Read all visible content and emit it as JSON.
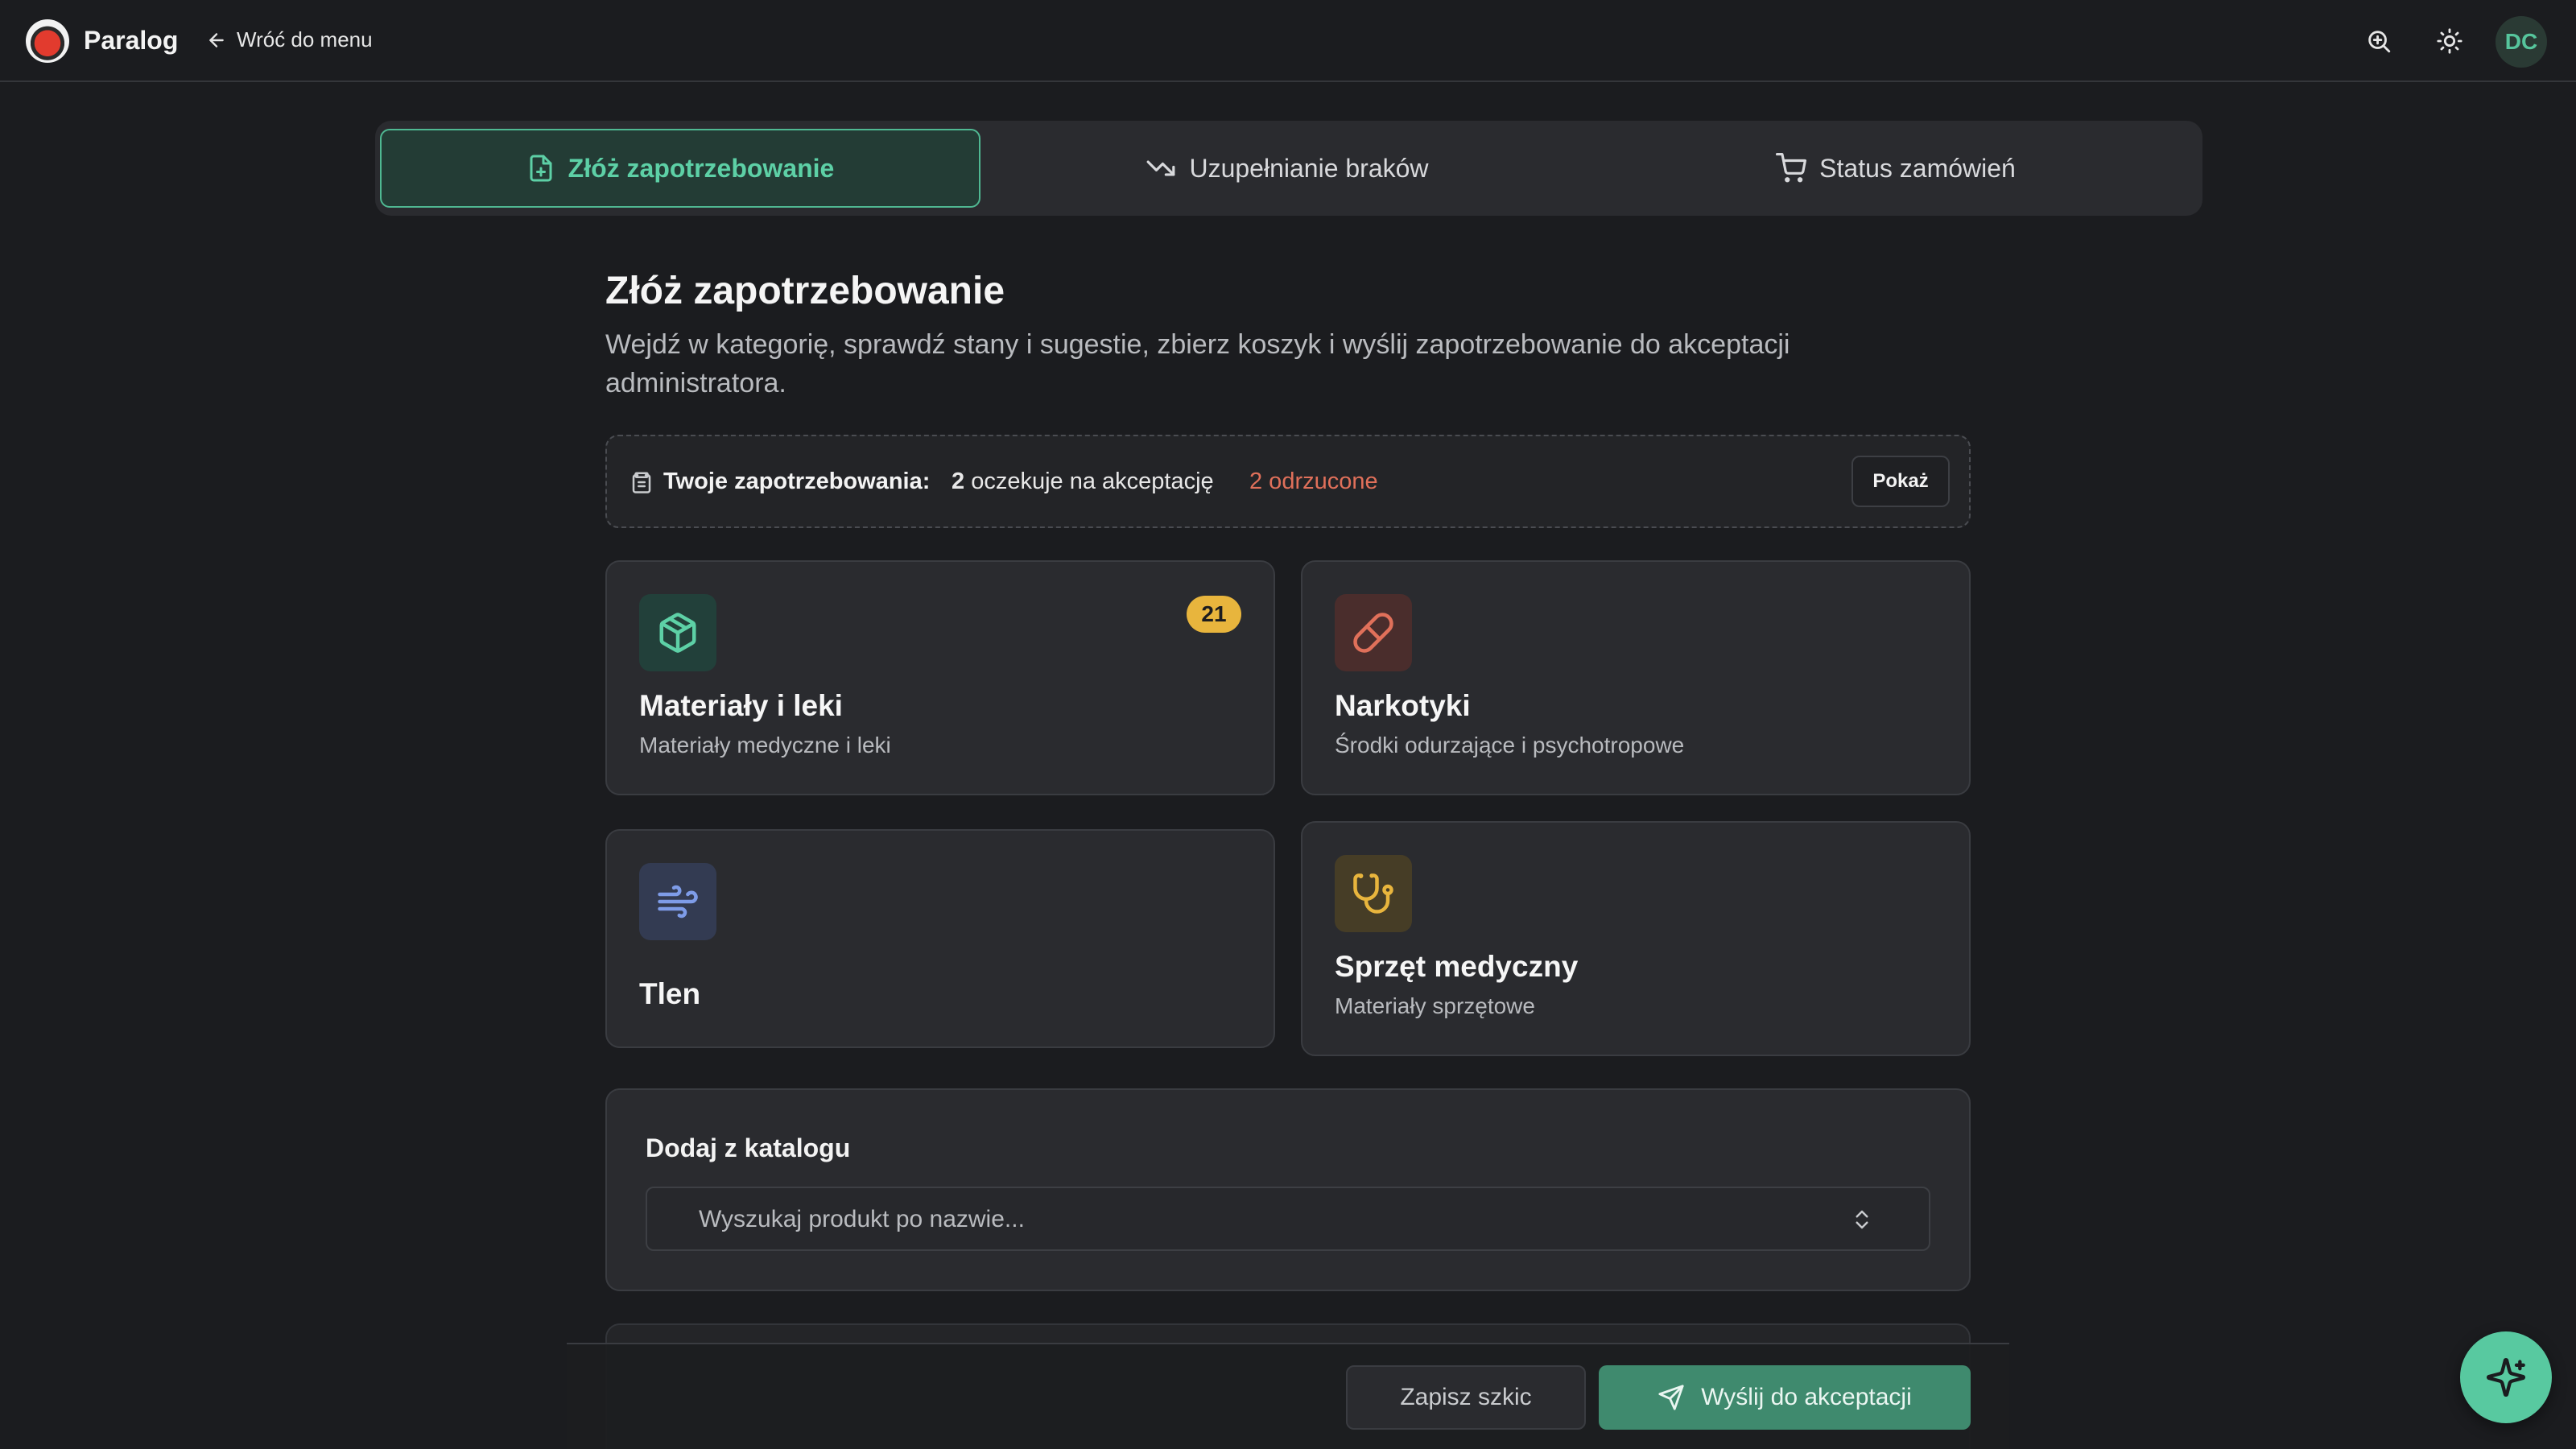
{
  "header": {
    "brand": "Paralog",
    "back_label": "Wróć do menu",
    "avatar_initials": "DC"
  },
  "tabs": [
    {
      "label": "Złóż zapotrzebowanie",
      "active": true,
      "icon": "file-plus-icon"
    },
    {
      "label": "Uzupełnianie braków",
      "active": false,
      "icon": "trending-down-icon"
    },
    {
      "label": "Status zamówień",
      "active": false,
      "icon": "cart-icon"
    }
  ],
  "page": {
    "title": "Złóż zapotrzebowanie",
    "description": "Wejdź w kategorię, sprawdź stany i sugestie, zbierz koszyk i wyślij zapotrzebowanie do akceptacji administratora."
  },
  "summary": {
    "label": "Twoje zapotrzebowania:",
    "pending_count": "2",
    "pending_text": "oczekuje na akceptację",
    "rejected_text": "2 odrzucone",
    "show_label": "Pokaż"
  },
  "categories": [
    {
      "title": "Materiały i leki",
      "subtitle": "Materiały medyczne i leki",
      "badge": "21",
      "icon": "package-icon",
      "color": "#5dd0a6"
    },
    {
      "title": "Narkotyki",
      "subtitle": "Środki odurzające i psychotropowe",
      "icon": "pill-icon",
      "color": "#e0705a"
    },
    {
      "title": "Tlen",
      "subtitle": "",
      "icon": "wind-icon",
      "color": "#7e9ce8"
    },
    {
      "title": "Sprzęt medyczny",
      "subtitle": "Materiały sprzętowe",
      "icon": "stethoscope-icon",
      "color": "#e8b53d"
    }
  ],
  "catalog": {
    "title": "Dodaj z katalogu",
    "search_placeholder": "Wyszukaj produkt po nazwie..."
  },
  "footer": {
    "draft_label": "Zapisz szkic",
    "send_label": "Wyślij do akceptacji"
  },
  "colors": {
    "accent": "#5dd0a6",
    "background": "#1b1c1f",
    "card": "#2a2b2f",
    "warning": "#e8b53d",
    "danger": "#e0705a"
  }
}
